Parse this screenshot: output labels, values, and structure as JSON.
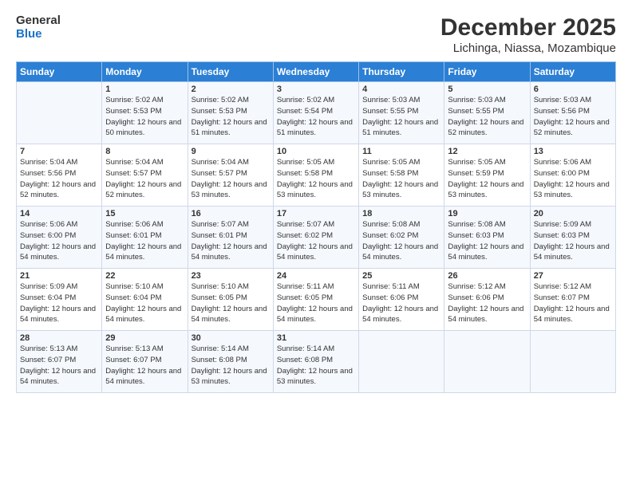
{
  "header": {
    "logo_general": "General",
    "logo_blue": "Blue",
    "month": "December 2025",
    "location": "Lichinga, Niassa, Mozambique"
  },
  "days_of_week": [
    "Sunday",
    "Monday",
    "Tuesday",
    "Wednesday",
    "Thursday",
    "Friday",
    "Saturday"
  ],
  "weeks": [
    [
      {
        "day": "",
        "sunrise": "",
        "sunset": "",
        "daylight": ""
      },
      {
        "day": "1",
        "sunrise": "Sunrise: 5:02 AM",
        "sunset": "Sunset: 5:53 PM",
        "daylight": "Daylight: 12 hours and 50 minutes."
      },
      {
        "day": "2",
        "sunrise": "Sunrise: 5:02 AM",
        "sunset": "Sunset: 5:53 PM",
        "daylight": "Daylight: 12 hours and 51 minutes."
      },
      {
        "day": "3",
        "sunrise": "Sunrise: 5:02 AM",
        "sunset": "Sunset: 5:54 PM",
        "daylight": "Daylight: 12 hours and 51 minutes."
      },
      {
        "day": "4",
        "sunrise": "Sunrise: 5:03 AM",
        "sunset": "Sunset: 5:55 PM",
        "daylight": "Daylight: 12 hours and 51 minutes."
      },
      {
        "day": "5",
        "sunrise": "Sunrise: 5:03 AM",
        "sunset": "Sunset: 5:55 PM",
        "daylight": "Daylight: 12 hours and 52 minutes."
      },
      {
        "day": "6",
        "sunrise": "Sunrise: 5:03 AM",
        "sunset": "Sunset: 5:56 PM",
        "daylight": "Daylight: 12 hours and 52 minutes."
      }
    ],
    [
      {
        "day": "7",
        "sunrise": "Sunrise: 5:04 AM",
        "sunset": "Sunset: 5:56 PM",
        "daylight": "Daylight: 12 hours and 52 minutes."
      },
      {
        "day": "8",
        "sunrise": "Sunrise: 5:04 AM",
        "sunset": "Sunset: 5:57 PM",
        "daylight": "Daylight: 12 hours and 52 minutes."
      },
      {
        "day": "9",
        "sunrise": "Sunrise: 5:04 AM",
        "sunset": "Sunset: 5:57 PM",
        "daylight": "Daylight: 12 hours and 53 minutes."
      },
      {
        "day": "10",
        "sunrise": "Sunrise: 5:05 AM",
        "sunset": "Sunset: 5:58 PM",
        "daylight": "Daylight: 12 hours and 53 minutes."
      },
      {
        "day": "11",
        "sunrise": "Sunrise: 5:05 AM",
        "sunset": "Sunset: 5:58 PM",
        "daylight": "Daylight: 12 hours and 53 minutes."
      },
      {
        "day": "12",
        "sunrise": "Sunrise: 5:05 AM",
        "sunset": "Sunset: 5:59 PM",
        "daylight": "Daylight: 12 hours and 53 minutes."
      },
      {
        "day": "13",
        "sunrise": "Sunrise: 5:06 AM",
        "sunset": "Sunset: 6:00 PM",
        "daylight": "Daylight: 12 hours and 53 minutes."
      }
    ],
    [
      {
        "day": "14",
        "sunrise": "Sunrise: 5:06 AM",
        "sunset": "Sunset: 6:00 PM",
        "daylight": "Daylight: 12 hours and 54 minutes."
      },
      {
        "day": "15",
        "sunrise": "Sunrise: 5:06 AM",
        "sunset": "Sunset: 6:01 PM",
        "daylight": "Daylight: 12 hours and 54 minutes."
      },
      {
        "day": "16",
        "sunrise": "Sunrise: 5:07 AM",
        "sunset": "Sunset: 6:01 PM",
        "daylight": "Daylight: 12 hours and 54 minutes."
      },
      {
        "day": "17",
        "sunrise": "Sunrise: 5:07 AM",
        "sunset": "Sunset: 6:02 PM",
        "daylight": "Daylight: 12 hours and 54 minutes."
      },
      {
        "day": "18",
        "sunrise": "Sunrise: 5:08 AM",
        "sunset": "Sunset: 6:02 PM",
        "daylight": "Daylight: 12 hours and 54 minutes."
      },
      {
        "day": "19",
        "sunrise": "Sunrise: 5:08 AM",
        "sunset": "Sunset: 6:03 PM",
        "daylight": "Daylight: 12 hours and 54 minutes."
      },
      {
        "day": "20",
        "sunrise": "Sunrise: 5:09 AM",
        "sunset": "Sunset: 6:03 PM",
        "daylight": "Daylight: 12 hours and 54 minutes."
      }
    ],
    [
      {
        "day": "21",
        "sunrise": "Sunrise: 5:09 AM",
        "sunset": "Sunset: 6:04 PM",
        "daylight": "Daylight: 12 hours and 54 minutes."
      },
      {
        "day": "22",
        "sunrise": "Sunrise: 5:10 AM",
        "sunset": "Sunset: 6:04 PM",
        "daylight": "Daylight: 12 hours and 54 minutes."
      },
      {
        "day": "23",
        "sunrise": "Sunrise: 5:10 AM",
        "sunset": "Sunset: 6:05 PM",
        "daylight": "Daylight: 12 hours and 54 minutes."
      },
      {
        "day": "24",
        "sunrise": "Sunrise: 5:11 AM",
        "sunset": "Sunset: 6:05 PM",
        "daylight": "Daylight: 12 hours and 54 minutes."
      },
      {
        "day": "25",
        "sunrise": "Sunrise: 5:11 AM",
        "sunset": "Sunset: 6:06 PM",
        "daylight": "Daylight: 12 hours and 54 minutes."
      },
      {
        "day": "26",
        "sunrise": "Sunrise: 5:12 AM",
        "sunset": "Sunset: 6:06 PM",
        "daylight": "Daylight: 12 hours and 54 minutes."
      },
      {
        "day": "27",
        "sunrise": "Sunrise: 5:12 AM",
        "sunset": "Sunset: 6:07 PM",
        "daylight": "Daylight: 12 hours and 54 minutes."
      }
    ],
    [
      {
        "day": "28",
        "sunrise": "Sunrise: 5:13 AM",
        "sunset": "Sunset: 6:07 PM",
        "daylight": "Daylight: 12 hours and 54 minutes."
      },
      {
        "day": "29",
        "sunrise": "Sunrise: 5:13 AM",
        "sunset": "Sunset: 6:07 PM",
        "daylight": "Daylight: 12 hours and 54 minutes."
      },
      {
        "day": "30",
        "sunrise": "Sunrise: 5:14 AM",
        "sunset": "Sunset: 6:08 PM",
        "daylight": "Daylight: 12 hours and 53 minutes."
      },
      {
        "day": "31",
        "sunrise": "Sunrise: 5:14 AM",
        "sunset": "Sunset: 6:08 PM",
        "daylight": "Daylight: 12 hours and 53 minutes."
      },
      {
        "day": "",
        "sunrise": "",
        "sunset": "",
        "daylight": ""
      },
      {
        "day": "",
        "sunrise": "",
        "sunset": "",
        "daylight": ""
      },
      {
        "day": "",
        "sunrise": "",
        "sunset": "",
        "daylight": ""
      }
    ]
  ]
}
